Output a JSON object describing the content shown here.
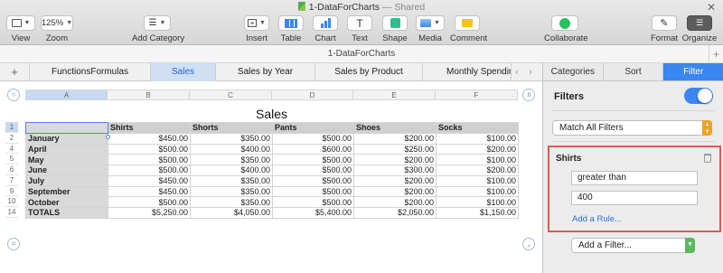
{
  "window": {
    "title": "1-DataForCharts",
    "title_suffix": "— Shared"
  },
  "toolbar": {
    "view": {
      "label": "View"
    },
    "zoom": {
      "value": "125%",
      "label": "Zoom"
    },
    "add_category": {
      "label": "Add Category"
    },
    "insert": {
      "label": "Insert"
    },
    "table": {
      "label": "Table"
    },
    "chart": {
      "label": "Chart"
    },
    "text": {
      "label": "Text"
    },
    "shape": {
      "label": "Shape"
    },
    "media": {
      "label": "Media"
    },
    "comment": {
      "label": "Comment"
    },
    "collaborate": {
      "label": "Collaborate"
    },
    "format": {
      "label": "Format"
    },
    "organize": {
      "label": "Organize"
    }
  },
  "sheet_title_strip": "1-DataForCharts",
  "sheet_tabs": [
    {
      "label": "FunctionsFormulas"
    },
    {
      "label": "Sales"
    },
    {
      "label": "Sales by Year"
    },
    {
      "label": "Sales by Product"
    },
    {
      "label": "Monthly Spending"
    }
  ],
  "table": {
    "title": "Sales",
    "columns": [
      "A",
      "B",
      "C",
      "D",
      "E",
      "F"
    ],
    "header_row_num": "1",
    "headers": [
      "",
      "Shirts",
      "Shorts",
      "Pants",
      "Shoes",
      "Socks"
    ],
    "rows": [
      {
        "num": "2",
        "label": "January",
        "values": [
          "$450.00",
          "$350.00",
          "$500.00",
          "$200.00",
          "$100.00"
        ]
      },
      {
        "num": "4",
        "label": "April",
        "values": [
          "$500.00",
          "$400.00",
          "$600.00",
          "$250.00",
          "$200.00"
        ]
      },
      {
        "num": "5",
        "label": "May",
        "values": [
          "$500.00",
          "$350.00",
          "$500.00",
          "$200.00",
          "$100.00"
        ]
      },
      {
        "num": "6",
        "label": "June",
        "values": [
          "$500.00",
          "$400.00",
          "$500.00",
          "$300.00",
          "$200.00"
        ]
      },
      {
        "num": "7",
        "label": "July",
        "values": [
          "$450.00",
          "$350.00",
          "$500.00",
          "$200.00",
          "$100.00"
        ]
      },
      {
        "num": "9",
        "label": "September",
        "values": [
          "$450.00",
          "$350.00",
          "$500.00",
          "$200.00",
          "$100.00"
        ]
      },
      {
        "num": "10",
        "label": "October",
        "values": [
          "$500.00",
          "$350.00",
          "$500.00",
          "$200.00",
          "$100.00"
        ]
      },
      {
        "num": "14",
        "label": "TOTALS",
        "values": [
          "$5,250.00",
          "$4,050.00",
          "$5,400.00",
          "$2,050.00",
          "$1,150.00"
        ]
      }
    ]
  },
  "inspector": {
    "tabs": [
      "Categories",
      "Sort",
      "Filter"
    ],
    "active_tab": "Filter",
    "filters_label": "Filters",
    "filters_enabled": true,
    "match_mode": "Match All Filters",
    "rule": {
      "column": "Shirts",
      "operator": "greater than",
      "value": "400",
      "add_rule_label": "Add a Rule..."
    },
    "add_filter_label": "Add a Filter..."
  },
  "colors": {
    "accent": "#3b86f0",
    "highlight_box": "#e05a55",
    "select_arrow_orange": "#f0a020",
    "select_arrow_green": "#5cb85c"
  }
}
